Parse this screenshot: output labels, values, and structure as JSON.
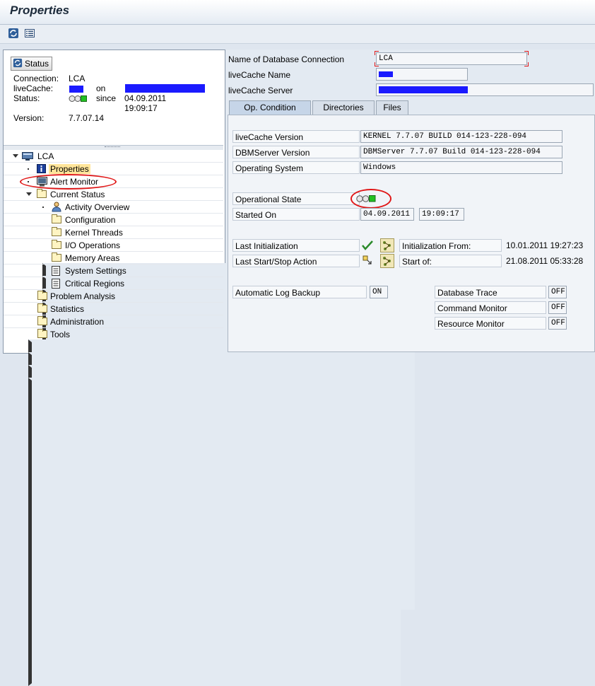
{
  "window": {
    "title": "Properties"
  },
  "toolbar": {
    "refresh_icon": "refresh-icon",
    "list_icon": "list-icon"
  },
  "status": {
    "button_label": "Status",
    "connection_label": "Connection:",
    "connection_value": "LCA",
    "livecache_label": "liveCache:",
    "on_label": "on",
    "status_label": "Status:",
    "since_label": "since",
    "since_date": "04.09.2011",
    "since_time": "19:09:17",
    "version_label": "Version:",
    "version_value": "7.7.07.14"
  },
  "tree": {
    "root": "LCA",
    "items": [
      {
        "label": "Properties"
      },
      {
        "label": "Alert Monitor"
      },
      {
        "label": "Current Status"
      },
      {
        "label": "Activity Overview"
      },
      {
        "label": "Configuration"
      },
      {
        "label": "Kernel Threads"
      },
      {
        "label": "I/O Operations"
      },
      {
        "label": "Memory Areas"
      },
      {
        "label": "System Settings"
      },
      {
        "label": "Critical Regions"
      },
      {
        "label": "Problem Analysis"
      },
      {
        "label": "Statistics"
      },
      {
        "label": "Administration"
      },
      {
        "label": "Tools"
      }
    ]
  },
  "header_fields": {
    "db_connection_label": "Name of Database Connection",
    "db_connection_value": "LCA",
    "livecache_name_label": "liveCache Name",
    "livecache_server_label": "liveCache Server"
  },
  "tabs": [
    {
      "label": "Op. Condition",
      "active": true
    },
    {
      "label": "Directories",
      "active": false
    },
    {
      "label": "Files",
      "active": false
    }
  ],
  "op_condition": {
    "livecache_version_label": "liveCache Version",
    "livecache_version_value": "KERNEL    7.7.07   BUILD 014-123-228-094",
    "dbmserver_version_label": "DBMServer Version",
    "dbmserver_version_value": "DBMServer 7.7.07   Build 014-123-228-094",
    "os_label": "Operating System",
    "os_value": "Windows",
    "operational_state_label": "Operational State",
    "started_on_label": "Started On",
    "started_on_date": "04.09.2011",
    "started_on_time": "19:09:17",
    "last_init_label": "Last Initialization",
    "init_from_label": "Initialization From:",
    "init_from_value": "10.01.2011 19:27:23",
    "last_startstop_label": "Last Start/Stop Action",
    "start_of_label": "Start of:",
    "start_of_value": "21.08.2011 05:33:28",
    "auto_log_backup_label": "Automatic Log Backup",
    "auto_log_backup_value": "ON",
    "db_trace_label": "Database Trace",
    "db_trace_value": "OFF",
    "command_monitor_label": "Command Monitor",
    "command_monitor_value": "OFF",
    "resource_monitor_label": "Resource Monitor",
    "resource_monitor_value": "OFF"
  },
  "colors": {
    "annotation_red": "#e01818",
    "redaction_blue": "#1a1aff",
    "status_green": "#22c022"
  }
}
